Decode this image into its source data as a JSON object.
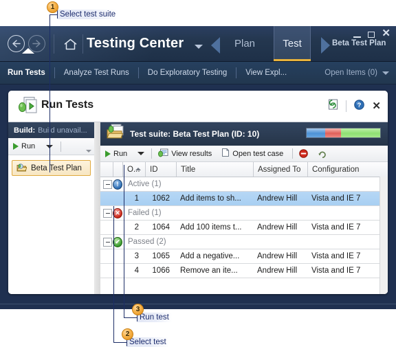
{
  "callouts": [
    {
      "num": "1",
      "label": "Select test suite"
    },
    {
      "num": "2",
      "label": "Select test"
    },
    {
      "num": "3",
      "label": "Run test"
    }
  ],
  "titlebar": {
    "app_title": "Testing Center",
    "back_icon": "back-arrow-icon",
    "forward_icon": "forward-arrow-icon",
    "home_icon": "home-icon",
    "dropdown_icon": "chevron-down-icon",
    "hubs": [
      {
        "label": "Plan",
        "active": false
      },
      {
        "label": "Test",
        "active": true
      }
    ],
    "plan_name": "Beta Test Plan",
    "window_controls": {
      "minimize": "minimize-icon",
      "maximize": "maximize-icon",
      "close": "✕"
    }
  },
  "menubar": {
    "items": [
      {
        "label": "Run Tests",
        "active": true
      },
      {
        "label": "Analyze Test Runs",
        "active": false
      },
      {
        "label": "Do Exploratory Testing",
        "active": false
      },
      {
        "label": "View Expl...",
        "active": false
      }
    ],
    "open_items": "Open Items (0)"
  },
  "panel": {
    "title": "Run Tests",
    "title_icon": "run-tests-icon",
    "header_icons": {
      "refresh": "refresh-icon",
      "help": "help-icon",
      "close": "✕"
    }
  },
  "left_pane": {
    "build_label": "Build:",
    "build_value": "Build unavail...",
    "run_button": "Run",
    "run_icon": "play-icon",
    "dropdown_icon": "chevron-down-icon",
    "overflow_icon": "overflow-chevron-icon",
    "tree": [
      {
        "label": "Beta Test Plan",
        "icon": "test-suite-folder-icon",
        "selected": true
      }
    ]
  },
  "right_pane": {
    "suite_icon": "test-suite-folder-icon",
    "suite_label": "Test suite:  Beta Test Plan (ID: 10)",
    "progress": {
      "blue_pct": 25,
      "red_pct": 22,
      "green_pct": 53,
      "blue_color": "#4d92d6",
      "red_color": "#e0605a",
      "green_color": "#8fe073"
    },
    "toolbar": {
      "run": "Run",
      "run_icon": "play-icon",
      "dropdown_icon": "chevron-down-icon",
      "view_results": "View results",
      "view_results_icon": "view-results-icon",
      "open_test_case": "Open test case",
      "open_test_case_icon": "open-test-case-icon",
      "block_icon": "block-test-icon",
      "reset_icon": "reset-test-icon"
    }
  },
  "grid": {
    "columns": [
      {
        "key": "expander",
        "label": ""
      },
      {
        "key": "icon",
        "label": ""
      },
      {
        "key": "order",
        "label": "O...",
        "sorted": "asc"
      },
      {
        "key": "id",
        "label": "ID"
      },
      {
        "key": "title",
        "label": "Title"
      },
      {
        "key": "assigned_to",
        "label": "Assigned To"
      },
      {
        "key": "configuration",
        "label": "Configuration"
      }
    ],
    "groups": [
      {
        "name": "Active (1)",
        "status": "active",
        "status_icon": "info-circle-icon",
        "glyph": "!",
        "rows": [
          {
            "order": "1",
            "id": "1062",
            "title": "Add items to sh...",
            "assigned_to": "Andrew Hill",
            "configuration": "Vista and IE 7",
            "selected": true
          }
        ]
      },
      {
        "name": "Failed (1)",
        "status": "failed",
        "status_icon": "error-circle-icon",
        "glyph": "✕",
        "rows": [
          {
            "order": "2",
            "id": "1064",
            "title": "Add 100 items t...",
            "assigned_to": "Andrew Hill",
            "configuration": "Vista and IE 7",
            "selected": false
          }
        ]
      },
      {
        "name": "Passed (2)",
        "status": "passed",
        "status_icon": "check-circle-icon",
        "glyph": "✔",
        "rows": [
          {
            "order": "3",
            "id": "1065",
            "title": "Add a negative...",
            "assigned_to": "Andrew Hill",
            "configuration": "Vista and IE 7",
            "selected": false
          },
          {
            "order": "4",
            "id": "1066",
            "title": "Remove an ite...",
            "assigned_to": "Andrew Hill",
            "configuration": "Vista and IE 7",
            "selected": false
          }
        ]
      }
    ]
  }
}
